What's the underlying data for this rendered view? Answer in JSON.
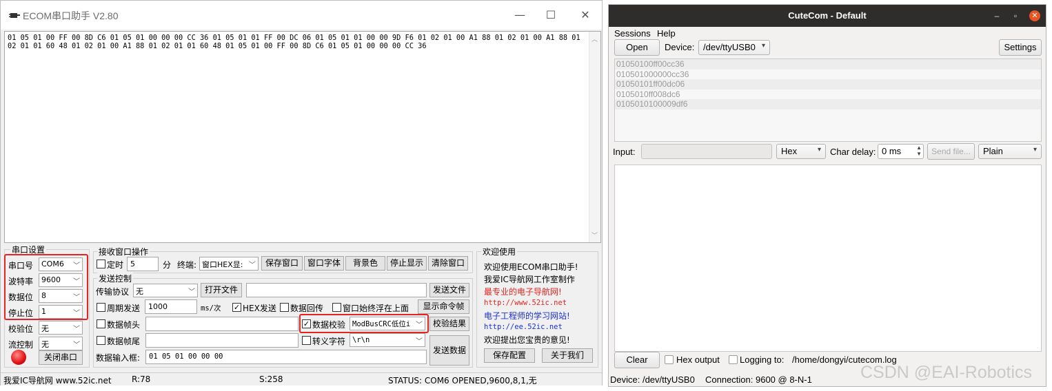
{
  "ecom": {
    "title": "ECOM串口助手   V2.80",
    "window_controls": {
      "minimize": "—",
      "maximize": "☐",
      "close": "✕"
    },
    "rx_text": "01 05 01 00 FF 00 8D C6 01 05 01 00 00 00 CC 36 01 05 01 01 FF 00 DC 06 01 05 01 01 00 00 9D F6 01 02 01 00 A1 88 01 02 01 00 A1 88 01 02 01 01 60 48 01 02 01 00 A1 88 01 02 01 01 60 48 01 05 01 00 FF 00 8D C6 01 05 01 00 00 00 CC 36",
    "serial_settings": {
      "title": "串口设置",
      "port_label": "串口号",
      "port_value": "COM6",
      "baud_label": "波特率",
      "baud_value": "9600",
      "data_bits_label": "数据位",
      "data_bits_value": "8",
      "stop_bits_label": "停止位",
      "stop_bits_value": "1",
      "parity_label": "校验位",
      "parity_value": "无",
      "flow_label": "流控制",
      "flow_value": "无",
      "close_port_button": "关闭串口"
    },
    "receive_ops": {
      "title": "接收窗口操作",
      "timer_label": "定时",
      "timer_value": "5",
      "minute_label": "分",
      "terminal_label": "终端:",
      "terminal_value": "窗口HEX显:",
      "save_window": "保存窗口",
      "window_font": "窗口字体",
      "background_color": "背景色",
      "stop_display": "停止显示",
      "clear_window": "清除窗口"
    },
    "send_ctrl": {
      "title": "发送控制",
      "protocol_label": "传输协议",
      "protocol_value": "无",
      "open_file": "打开文件",
      "send_file": "发送文件",
      "periodic_label": "周期发送",
      "periodic_value": "1000",
      "unit_label": "ms/次",
      "hex_send_label": "HEX发送",
      "echo_label": "数据回传",
      "on_top_label": "窗口始终浮在上面",
      "show_frame": "显示命令帧",
      "frame_head_label": "数据帧头",
      "checksum_label": "数据校验",
      "checksum_value": "ModBusCRC低位i",
      "checksum_result": "校验结果",
      "frame_tail_label": "数据帧尾",
      "escape_label": "转义字符",
      "escape_value": "\\r\\n",
      "input_label": "数据输入框:",
      "input_value": "01 05 01 00 00 00",
      "send_data": "发送数据"
    },
    "welcome": {
      "title": "欢迎使用",
      "line1": "欢迎使用ECOM串口助手!",
      "line2": "我爱IC导航网工作室制作",
      "line3": "最专业的电子导航网!",
      "line4": "http://www.52ic.net",
      "line5": "电子工程师的学习网站!",
      "line6": "http://ee.52ic.net",
      "line7": "欢迎提出您宝贵的意见!",
      "save_config": "保存配置",
      "about_us": "关于我们"
    },
    "status": {
      "site": "我爱IC导航网 www.52ic.net",
      "rx": "R:78",
      "tx": "S:258",
      "status": "STATUS: COM6 OPENED,9600,8,1,无"
    },
    "colors": {
      "highlight_box": "#e8231f",
      "welcome_red": "#e8231f",
      "welcome_blue": "#1a2fd6"
    }
  },
  "cutecom": {
    "title": "CuteCom - Default",
    "menu": [
      "Sessions",
      "Help"
    ],
    "open_button": "Open",
    "device_label": "Device:",
    "device_value": "/dev/ttyUSB0",
    "settings_button": "Settings",
    "log_lines": [
      "01050100ff00cc36",
      "010501000000cc36",
      "01050101ff00dc06",
      "0105010ff008dc6",
      "0105010100009df6"
    ],
    "input_label": "Input:",
    "input_value": "",
    "format_value": "Hex",
    "char_delay_label": "Char delay:",
    "char_delay_value": "0 ms",
    "send_file_button": "Send file...",
    "line_end_value": "Plain",
    "clear_button": "Clear",
    "hex_output_label": "Hex output",
    "logging_label": "Logging to:",
    "logging_path": "/home/dongyi/cutecom.log",
    "status_device": "Device:  /dev/ttyUSB0",
    "status_connection": "Connection:  9600 @ 8-N-1",
    "colors": {
      "titlebar": "#2e2d2b",
      "close_button": "#e95420"
    }
  },
  "watermark": "CSDN @EAI-Robotics"
}
